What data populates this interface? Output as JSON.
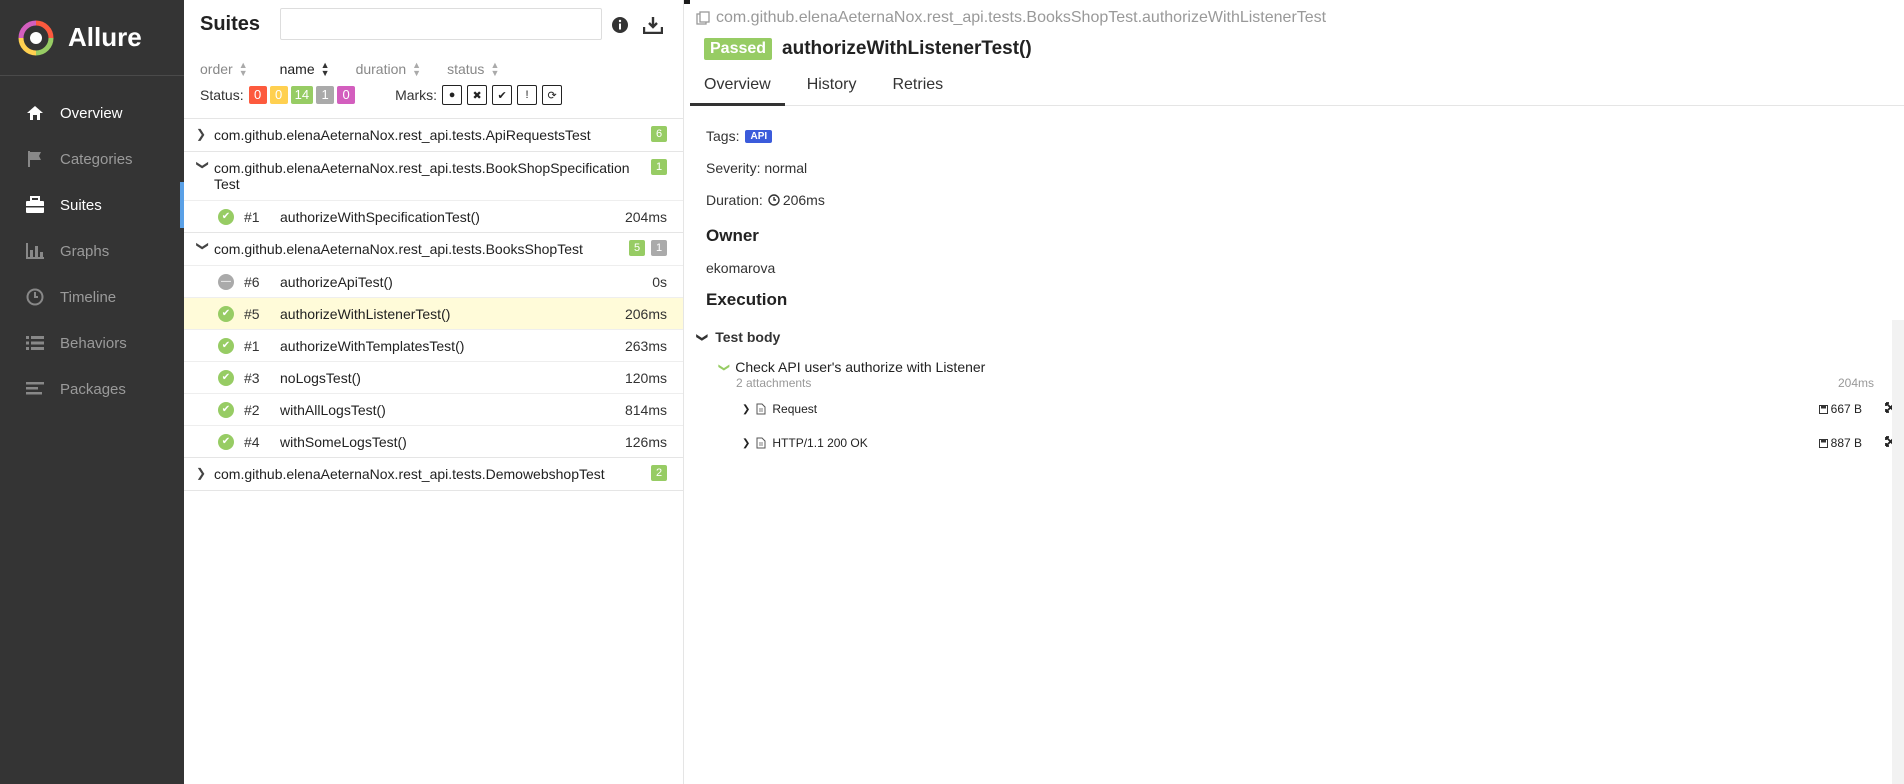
{
  "app": {
    "name": "Allure"
  },
  "nav": [
    {
      "label": "Overview",
      "icon": "home-icon"
    },
    {
      "label": "Categories",
      "icon": "flag-icon"
    },
    {
      "label": "Suites",
      "icon": "briefcase-icon"
    },
    {
      "label": "Graphs",
      "icon": "bar-chart-icon"
    },
    {
      "label": "Timeline",
      "icon": "clock-icon"
    },
    {
      "label": "Behaviors",
      "icon": "list-icon"
    },
    {
      "label": "Packages",
      "icon": "align-left-icon"
    }
  ],
  "suites": {
    "title": "Suites",
    "search_placeholder": "",
    "sort": {
      "order": "order",
      "name": "name",
      "duration": "duration",
      "status": "status"
    },
    "status_label": "Status:",
    "status_counts": {
      "failed": "0",
      "broken": "0",
      "passed": "14",
      "skipped": "1",
      "unknown": "0"
    },
    "marks_label": "Marks:",
    "groups": [
      {
        "name": "com.github.elenaAeternaNox.rest_api.tests.ApiRequestsTest",
        "expanded": false,
        "badges": [
          {
            "value": "6",
            "color": "green"
          }
        ],
        "tests": []
      },
      {
        "name": "com.github.elenaAeternaNox.rest_api.tests.BookShopSpecificationTest",
        "expanded": true,
        "badges": [
          {
            "value": "1",
            "color": "green"
          }
        ],
        "tests": [
          {
            "order": "#1",
            "name": "authorizeWithSpecificationTest()",
            "duration": "204ms",
            "status": "passed"
          }
        ]
      },
      {
        "name": "com.github.elenaAeternaNox.rest_api.tests.BooksShopTest",
        "expanded": true,
        "badges": [
          {
            "value": "5",
            "color": "green"
          },
          {
            "value": "1",
            "color": "grey"
          }
        ],
        "tests": [
          {
            "order": "#6",
            "name": "authorizeApiTest()",
            "duration": "0s",
            "status": "skipped"
          },
          {
            "order": "#5",
            "name": "authorizeWithListenerTest()",
            "duration": "206ms",
            "status": "passed"
          },
          {
            "order": "#1",
            "name": "authorizeWithTemplatesTest()",
            "duration": "263ms",
            "status": "passed"
          },
          {
            "order": "#3",
            "name": "noLogsTest()",
            "duration": "120ms",
            "status": "passed"
          },
          {
            "order": "#2",
            "name": "withAllLogsTest()",
            "duration": "814ms",
            "status": "passed"
          },
          {
            "order": "#4",
            "name": "withSomeLogsTest()",
            "duration": "126ms",
            "status": "passed"
          }
        ]
      },
      {
        "name": "com.github.elenaAeternaNox.rest_api.tests.DemowebshopTest",
        "expanded": false,
        "badges": [
          {
            "value": "2",
            "color": "green"
          }
        ],
        "tests": []
      }
    ]
  },
  "detail": {
    "breadcrumb": "com.github.elenaAeternaNox.rest_api.tests.BooksShopTest.authorizeWithListenerTest",
    "status": "Passed",
    "title": "authorizeWithListenerTest()",
    "tabs": [
      "Overview",
      "History",
      "Retries"
    ],
    "tags_label": "Tags:",
    "tag": "API",
    "severity": "Severity: normal",
    "duration_label": "Duration:",
    "duration": "206ms",
    "owner_heading": "Owner",
    "owner": "ekomarova",
    "execution_heading": "Execution",
    "test_body": "Test body",
    "step": {
      "name": "Check API user's authorize with Listener",
      "attachments": "2 attachments",
      "duration": "204ms"
    },
    "attachments": [
      {
        "name": "Request",
        "size": "667 B"
      },
      {
        "name": "HTTP/1.1 200 OK",
        "size": "887 B"
      }
    ]
  }
}
